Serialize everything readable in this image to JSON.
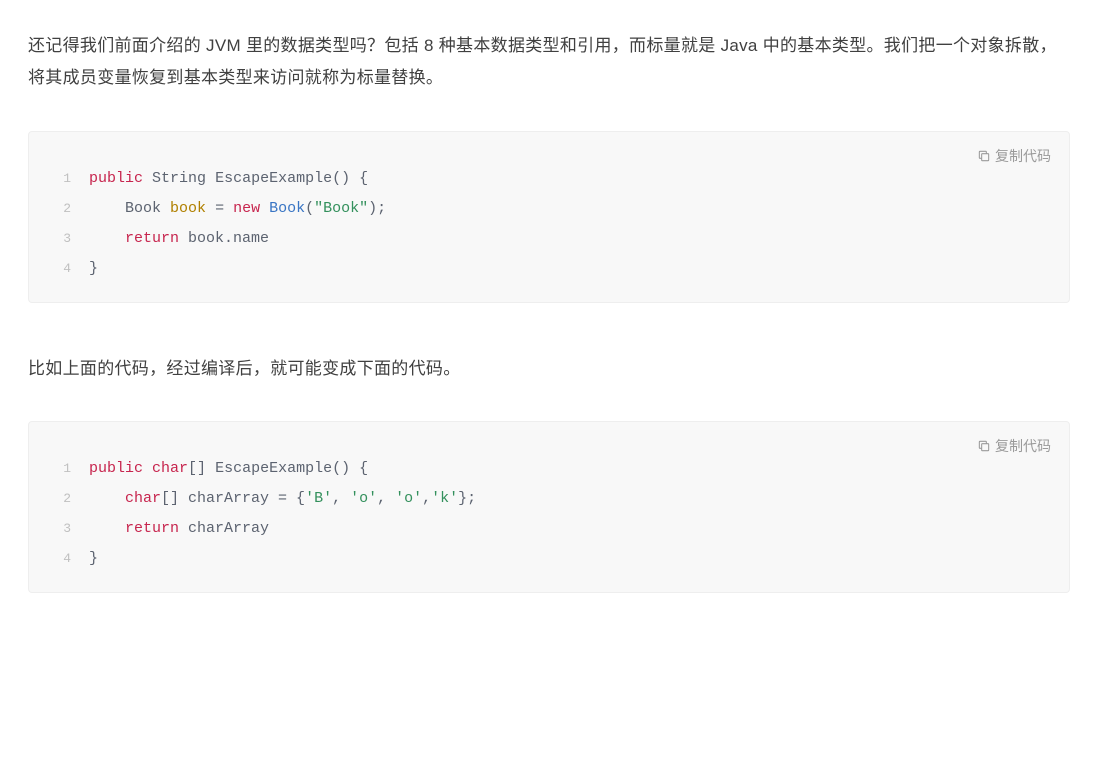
{
  "paragraphs": {
    "p1": "还记得我们前面介绍的 JVM 里的数据类型吗？包括 8 种基本数据类型和引用，而标量就是 Java 中的基本类型。我们把一个对象拆散，将其成员变量恢复到基本类型来访问就称为标量替换。",
    "p2": "比如上面的代码，经过编译后，就可能变成下面的代码。"
  },
  "copy_label": "复制代码",
  "code_blocks": {
    "block1": {
      "lines": [
        {
          "num": "1",
          "tokens": [
            {
              "t": "public",
              "c": "tok-keyword"
            },
            {
              "t": " ",
              "c": ""
            },
            {
              "t": "String",
              "c": "tok-type"
            },
            {
              "t": " ",
              "c": ""
            },
            {
              "t": "EscapeExample",
              "c": "tok-method"
            },
            {
              "t": "() {",
              "c": "tok-punct"
            }
          ]
        },
        {
          "num": "2",
          "tokens": [
            {
              "t": "    ",
              "c": ""
            },
            {
              "t": "Book",
              "c": "tok-type"
            },
            {
              "t": " ",
              "c": ""
            },
            {
              "t": "book",
              "c": "tok-var"
            },
            {
              "t": " = ",
              "c": "tok-op"
            },
            {
              "t": "new",
              "c": "tok-new"
            },
            {
              "t": " ",
              "c": ""
            },
            {
              "t": "Book",
              "c": "tok-class"
            },
            {
              "t": "(",
              "c": "tok-punct"
            },
            {
              "t": "\"Book\"",
              "c": "tok-string"
            },
            {
              "t": ");",
              "c": "tok-punct"
            }
          ]
        },
        {
          "num": "3",
          "tokens": [
            {
              "t": "    ",
              "c": ""
            },
            {
              "t": "return",
              "c": "tok-keyword"
            },
            {
              "t": " book.name",
              "c": "tok-ident"
            }
          ]
        },
        {
          "num": "4",
          "tokens": [
            {
              "t": "}",
              "c": "tok-punct"
            }
          ]
        }
      ]
    },
    "block2": {
      "lines": [
        {
          "num": "1",
          "tokens": [
            {
              "t": "public",
              "c": "tok-keyword"
            },
            {
              "t": " ",
              "c": ""
            },
            {
              "t": "char",
              "c": "tok-keyword"
            },
            {
              "t": "[] ",
              "c": "tok-punct"
            },
            {
              "t": "EscapeExample",
              "c": "tok-method"
            },
            {
              "t": "() {",
              "c": "tok-punct"
            }
          ]
        },
        {
          "num": "2",
          "tokens": [
            {
              "t": "    ",
              "c": ""
            },
            {
              "t": "char",
              "c": "tok-keyword"
            },
            {
              "t": "[] charArray = {",
              "c": "tok-punct"
            },
            {
              "t": "'B'",
              "c": "tok-char"
            },
            {
              "t": ", ",
              "c": "tok-punct"
            },
            {
              "t": "'o'",
              "c": "tok-char"
            },
            {
              "t": ", ",
              "c": "tok-punct"
            },
            {
              "t": "'o'",
              "c": "tok-char"
            },
            {
              "t": ",",
              "c": "tok-punct"
            },
            {
              "t": "'k'",
              "c": "tok-char"
            },
            {
              "t": "};",
              "c": "tok-punct"
            }
          ]
        },
        {
          "num": "3",
          "tokens": [
            {
              "t": "    ",
              "c": ""
            },
            {
              "t": "return",
              "c": "tok-keyword"
            },
            {
              "t": " charArray",
              "c": "tok-ident"
            }
          ]
        },
        {
          "num": "4",
          "tokens": [
            {
              "t": "}",
              "c": "tok-punct"
            }
          ]
        }
      ]
    }
  }
}
